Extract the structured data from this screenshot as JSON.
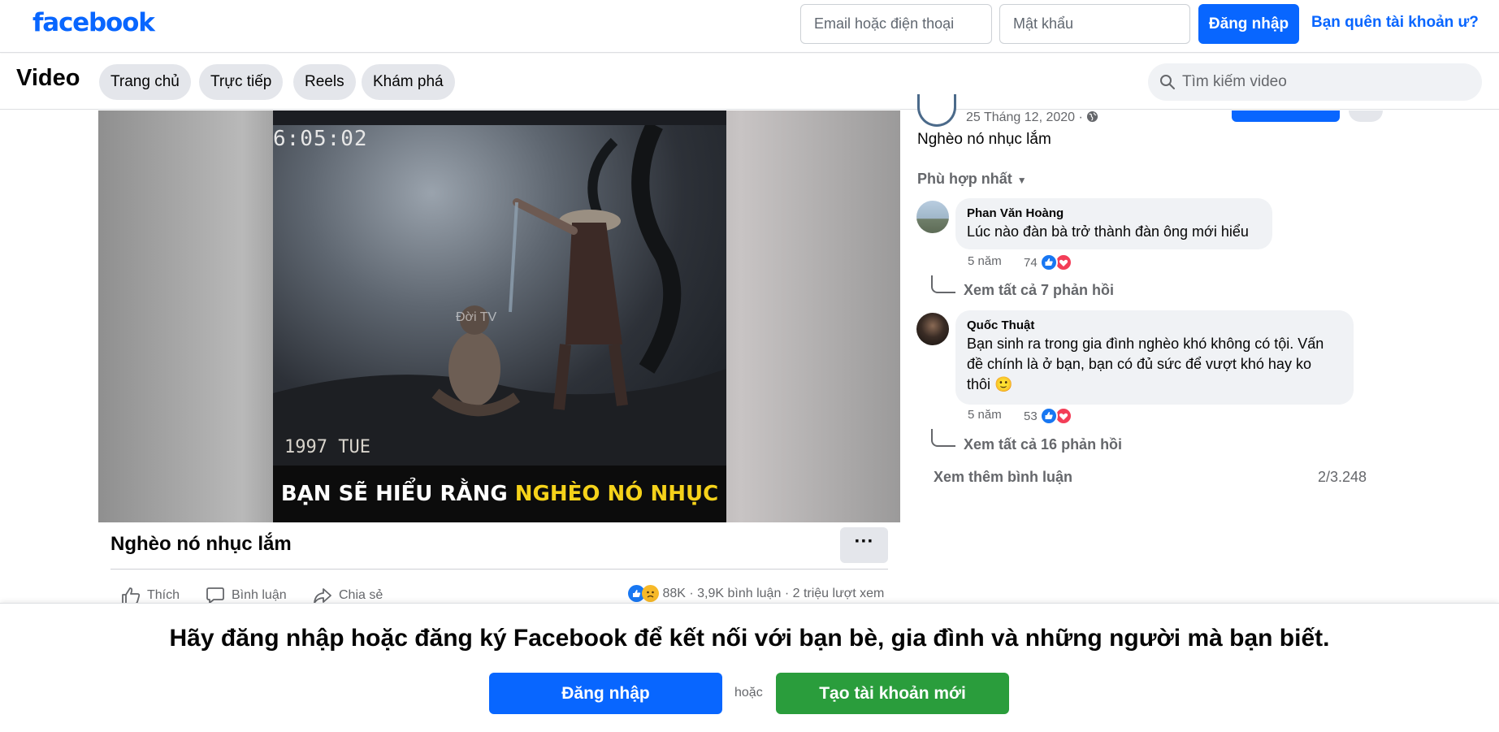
{
  "header": {
    "logo": "facebook",
    "email_placeholder": "Email hoặc điện thoại",
    "password_placeholder": "Mật khẩu",
    "login_label": "Đăng nhập",
    "forgot_label": "Bạn quên tài khoản ư?"
  },
  "nav": {
    "title": "Video",
    "tabs": [
      {
        "label": "Trang chủ"
      },
      {
        "label": "Trực tiếp"
      },
      {
        "label": "Reels"
      },
      {
        "label": "Khám phá"
      }
    ],
    "search_placeholder": "Tìm kiếm video"
  },
  "video": {
    "timestamp": "6:05:02",
    "date_stamp": "1997 TUE",
    "watermark": "Đời TV",
    "caption_plain": "BẠN SẼ HIỂU RẰNG ",
    "caption_highlight": "NGHÈO NÓ NHỤC LẮM",
    "title": "Nghèo nó nhục lắm",
    "more_label": "···"
  },
  "actions": {
    "like": "Thích",
    "comment": "Bình luận",
    "share": "Chia sẻ"
  },
  "stats": {
    "reactions": "88K",
    "comments": "3,9K bình luận",
    "views": "2 triệu lượt xem",
    "separator": "·"
  },
  "post": {
    "date": "25 Tháng 12, 2020 ·",
    "text": "Nghèo nó nhục lắm",
    "sort_label": "Phù hợp nhất"
  },
  "comments": [
    {
      "name": "Phan Văn Hoàng",
      "text": "Lúc nào đàn bà trở thành đàn ông mới hiểu",
      "time": "5 năm",
      "count": "74",
      "replies": "Xem tất cả 7 phản hồi"
    },
    {
      "name": "Quốc Thuật",
      "text_lines": [
        "Bạn sinh ra trong gia đình nghèo khó không có tội. Vấn",
        "đề chính là ở bạn, bạn có đủ sức để vượt khó hay ko",
        "thôi"
      ],
      "emoji": "🙂",
      "time": "5 năm",
      "count": "53",
      "replies": "Xem tất cả 16 phản hồi"
    }
  ],
  "more_comments": "Xem thêm bình luận",
  "comment_count": "2/3.248",
  "banner": {
    "text": "Hãy đăng nhập hoặc đăng ký Facebook để kết nối với bạn bè, gia đình và những người mà bạn biết.",
    "login_label": "Đăng nhập",
    "or_label": "hoặc",
    "create_label": "Tạo tài khoản mới"
  },
  "colors": {
    "brand": "#0866ff",
    "create_green": "#2a9d3c",
    "like_blue": "#1877f2",
    "love_red": "#f33e58",
    "haha_yellow": "#f7b928"
  },
  "icons": [
    "search-icon",
    "globe-icon",
    "like-icon",
    "comment-icon",
    "share-icon",
    "like-reaction-icon",
    "love-reaction-icon",
    "sad-reaction-icon",
    "chevron-down-icon",
    "more-icon"
  ]
}
